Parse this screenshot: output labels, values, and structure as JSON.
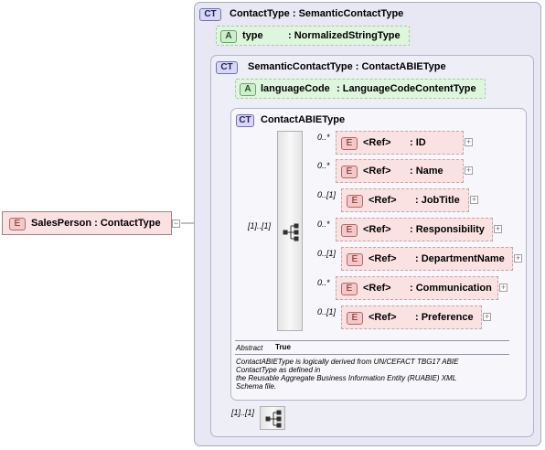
{
  "root": {
    "badge": "E",
    "label": "SalesPerson : ContactType"
  },
  "contact_type": {
    "badge": "CT",
    "title": "ContactType : SemanticContactType",
    "attr": {
      "badge": "A",
      "name": "type",
      "type": ": NormalizedStringType"
    }
  },
  "semantic_contact_type": {
    "badge": "CT",
    "title": "SemanticContactType : ContactABIEType",
    "attr": {
      "badge": "A",
      "name": "languageCode",
      "type": ": LanguageCodeContentType"
    }
  },
  "contact_abie_type": {
    "badge": "CT",
    "title": "ContactABIEType",
    "sequence_occurrence": "[1]..[1]",
    "elements": [
      {
        "occurrence": "0..*",
        "badge": "E",
        "ref": "<Ref>",
        "name": ": ID"
      },
      {
        "occurrence": "0..*",
        "badge": "E",
        "ref": "<Ref>",
        "name": ": Name"
      },
      {
        "occurrence": "0..[1]",
        "badge": "E",
        "ref": "<Ref>",
        "name": ": JobTitle"
      },
      {
        "occurrence": "0..*",
        "badge": "E",
        "ref": "<Ref>",
        "name": ": Responsibility"
      },
      {
        "occurrence": "0..[1]",
        "badge": "E",
        "ref": "<Ref>",
        "name": ": DepartmentName"
      },
      {
        "occurrence": "0..*",
        "badge": "E",
        "ref": "<Ref>",
        "name": ": Communication"
      },
      {
        "occurrence": "0..[1]",
        "badge": "E",
        "ref": "<Ref>",
        "name": ": Preference"
      }
    ],
    "abstract_label": "Abstract",
    "abstract_value": "True",
    "doc_lines": [
      "ContactABIEType is logically derived from UN/CEFACT TBG17 ABIE",
      "ContactType as defined in",
      "the Reusable Aggregate Business Information Entity (RUABIE) XML",
      "Schema file."
    ]
  },
  "outer_sequence_occurrence": "[1]..[1]"
}
